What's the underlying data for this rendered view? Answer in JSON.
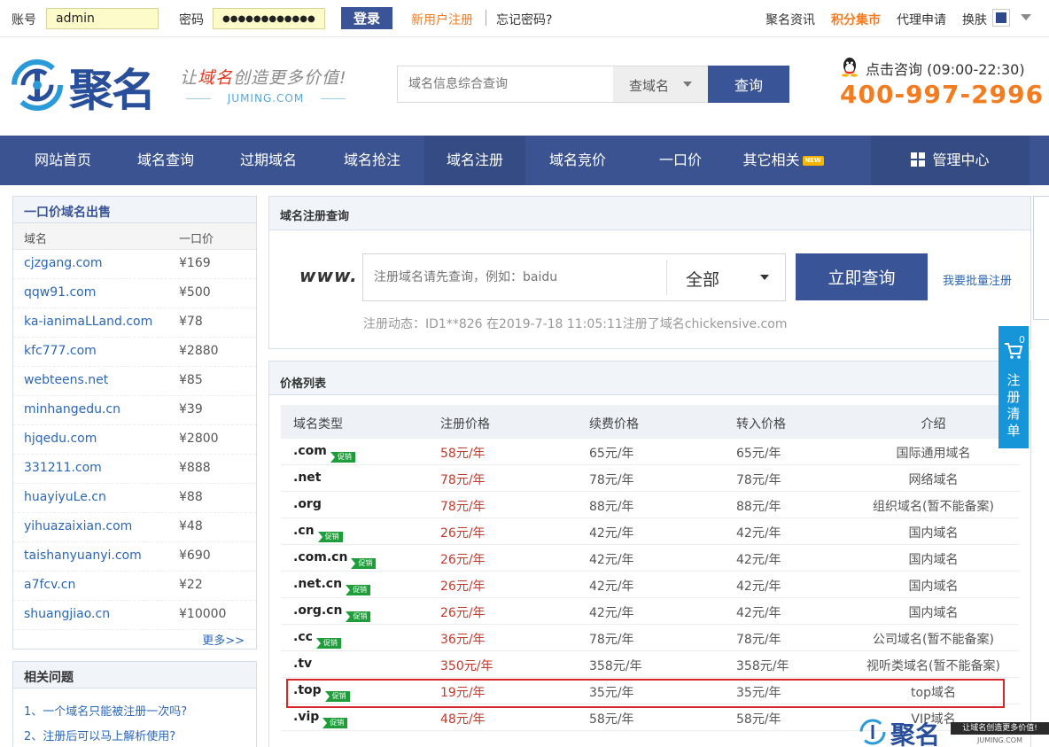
{
  "topbar": {
    "account_label": "账号",
    "account_value": "admin",
    "password_label": "密码",
    "password_value": "●●●●●●●●●●●●",
    "login_button": "登录",
    "register_link": "新用户注册",
    "forgot_link": "忘记密码?",
    "news_link": "聚名资讯",
    "points_link": "积分集市",
    "agent_link": "代理申请",
    "skin_label": "换肤",
    "colors": {
      "accent": "#3a5597",
      "orange": "#f47c20",
      "red": "#c0392b"
    }
  },
  "header": {
    "logo_text": "聚名",
    "slogan_prefix": "让",
    "slogan_red": "域名",
    "slogan_suffix": "创造更多价值!",
    "slogan_en": "JUMING.COM",
    "search_placeholder": "域名信息综合查询",
    "search_type": "查域名",
    "search_button": "查询",
    "consult_text": "点击咨询 (09:00-22:30)",
    "hotline": "400-997-2996"
  },
  "nav": {
    "items": [
      {
        "label": "网站首页"
      },
      {
        "label": "域名查询"
      },
      {
        "label": "过期域名"
      },
      {
        "label": "域名抢注"
      },
      {
        "label": "域名注册"
      },
      {
        "label": "域名竞价"
      },
      {
        "label": "一口价"
      },
      {
        "label": "其它相关"
      }
    ],
    "new_badge": "NEW",
    "management": "管理中心"
  },
  "sidebar": {
    "title": "一口价域名出售",
    "col_domain": "域名",
    "col_price": "一口价",
    "rows": [
      {
        "domain": "cjzgang.com",
        "price": "¥169"
      },
      {
        "domain": "qqw91.com",
        "price": "¥500"
      },
      {
        "domain": "ka-ianimaLLand.com",
        "price": "¥78"
      },
      {
        "domain": "kfc777.com",
        "price": "¥2880"
      },
      {
        "domain": "webteens.net",
        "price": "¥85"
      },
      {
        "domain": "minhangedu.cn",
        "price": "¥39"
      },
      {
        "domain": "hjqedu.com",
        "price": "¥2800"
      },
      {
        "domain": "331211.com",
        "price": "¥888"
      },
      {
        "domain": "huayiyuLe.cn",
        "price": "¥88"
      },
      {
        "domain": "yihuazaixian.com",
        "price": "¥48"
      },
      {
        "domain": "taishanyuanyi.com",
        "price": "¥690"
      },
      {
        "domain": "a7fcv.cn",
        "price": "¥22"
      },
      {
        "domain": "shuangjiao.cn",
        "price": "¥10000"
      }
    ],
    "more": "更多>>",
    "faq_title": "相关问题",
    "faq": [
      "1、一个域名只能被注册一次吗?",
      "2、注册后可以马上解析使用?"
    ]
  },
  "register": {
    "title": "域名注册查询",
    "www": "www.",
    "input_placeholder": "注册域名请先查询，例如：baidu",
    "suffix_select": "全部",
    "button": "立即查询",
    "batch_link": "我要批量注册",
    "dynamic": "注册动态：ID1**826 在2019-7-18 11:05:11注册了域名chickensive.com"
  },
  "price_list": {
    "title": "价格列表",
    "columns": [
      "域名类型",
      "注册价格",
      "续费价格",
      "转入价格",
      "介绍"
    ],
    "promo_label": "促销",
    "rows": [
      {
        "type": ".com",
        "promo": true,
        "reg": "58元/年",
        "renew": "65元/年",
        "transfer": "65元/年",
        "info": "国际通用域名"
      },
      {
        "type": ".net",
        "promo": false,
        "reg": "78元/年",
        "renew": "78元/年",
        "transfer": "78元/年",
        "info": "网络域名"
      },
      {
        "type": ".org",
        "promo": false,
        "reg": "78元/年",
        "renew": "88元/年",
        "transfer": "88元/年",
        "info": "组织域名(暂不能备案)"
      },
      {
        "type": ".cn",
        "promo": true,
        "reg": "26元/年",
        "renew": "42元/年",
        "transfer": "42元/年",
        "info": "国内域名"
      },
      {
        "type": ".com.cn",
        "promo": true,
        "reg": "26元/年",
        "renew": "42元/年",
        "transfer": "42元/年",
        "info": "国内域名"
      },
      {
        "type": ".net.cn",
        "promo": true,
        "reg": "26元/年",
        "renew": "42元/年",
        "transfer": "42元/年",
        "info": "国内域名"
      },
      {
        "type": ".org.cn",
        "promo": true,
        "reg": "26元/年",
        "renew": "42元/年",
        "transfer": "42元/年",
        "info": "国内域名"
      },
      {
        "type": ".cc",
        "promo": true,
        "reg": "36元/年",
        "renew": "78元/年",
        "transfer": "78元/年",
        "info": "公司域名(暂不能备案)"
      },
      {
        "type": ".tv",
        "promo": false,
        "reg": "350元/年",
        "renew": "358元/年",
        "transfer": "358元/年",
        "info": "视听类域名(暂不能备案)"
      },
      {
        "type": ".top",
        "promo": true,
        "reg": "19元/年",
        "renew": "35元/年",
        "transfer": "35元/年",
        "info": "top域名"
      },
      {
        "type": ".vip",
        "promo": true,
        "reg": "48元/年",
        "renew": "58元/年",
        "transfer": "58元/年",
        "info": "VIP域名"
      }
    ]
  },
  "cart": {
    "count": "0",
    "label": "注册清单"
  },
  "watermark": {
    "logo": "聚名",
    "slogan": "让域名创造更多价值!",
    "en": "JUMING.COM"
  }
}
